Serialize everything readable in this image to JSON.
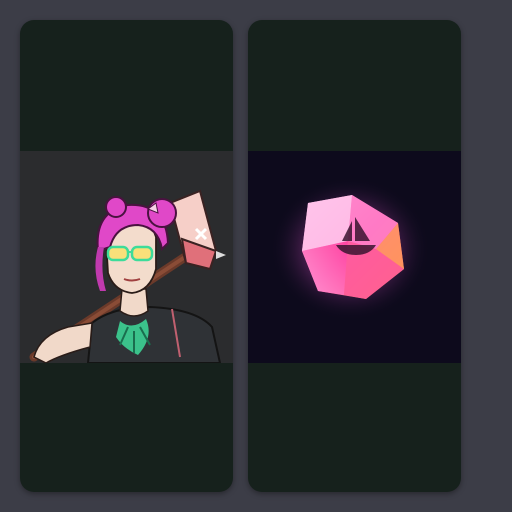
{
  "colors": {
    "page_background": "#3c3d47",
    "card_background": "#16211c",
    "left_media_background": "#2b2c2e",
    "right_media_background": "#0d0a1c",
    "accent_pink": "#e048c8",
    "accent_green": "#3ddc9a"
  },
  "cards": [
    {
      "media_icon": "punk-girl-with-axe-illustration"
    },
    {
      "media_icon": "glowing-pink-gem-with-ship-emblem-icon"
    }
  ]
}
